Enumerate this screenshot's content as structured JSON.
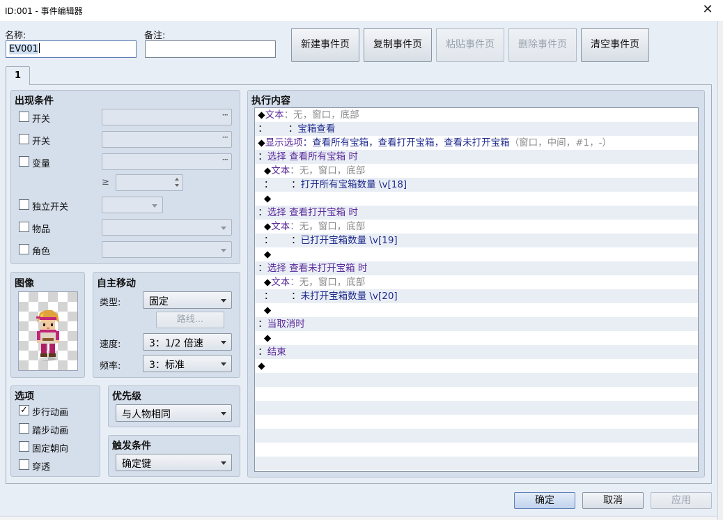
{
  "window": {
    "title": "ID:001 - 事件编辑器",
    "close_glyph": "✕"
  },
  "header": {
    "name_label": "名称:",
    "name_value": "EV001",
    "note_label": "备注:",
    "note_value": ""
  },
  "page_buttons": {
    "new": "新建事件页",
    "copy": "复制事件页",
    "paste": "粘贴事件页",
    "delete": "删除事件页",
    "clear": "清空事件页"
  },
  "tabs": [
    "1"
  ],
  "conditions": {
    "title": "出现条件",
    "switch1_label": "开关",
    "switch2_label": "开关",
    "variable_label": "变量",
    "ge_symbol": "≥",
    "self_switch_label": "独立开关",
    "item_label": "物品",
    "actor_label": "角色",
    "dots": "···"
  },
  "image": {
    "title": "图像",
    "character": "pink-haired-hero-sprite"
  },
  "autonomous_movement": {
    "title": "自主移动",
    "type_label": "类型:",
    "type_value": "固定",
    "route_button": "路线...",
    "speed_label": "速度:",
    "speed_value": "3：1/2 倍速",
    "freq_label": "频率:",
    "freq_value": "3：标准"
  },
  "options": {
    "title": "选项",
    "items": [
      {
        "label": "步行动画",
        "checked": true
      },
      {
        "label": "踏步动画",
        "checked": false
      },
      {
        "label": "固定朝向",
        "checked": false
      },
      {
        "label": "穿透",
        "checked": false
      }
    ],
    "check_glyph": "✓"
  },
  "priority": {
    "title": "优先级",
    "value": "与人物相同"
  },
  "trigger": {
    "title": "触发条件",
    "value": "确定键"
  },
  "contents": {
    "title": "执行内容",
    "rows": [
      [
        {
          "t": "◆",
          "c": "black"
        },
        {
          "t": "文本",
          "c": "purple"
        },
        {
          "t": "：无，窗口，底部",
          "c": "gray"
        }
      ],
      [
        {
          "t": "：       ：",
          "c": "black"
        },
        {
          "t": "宝箱查看",
          "c": "navy"
        }
      ],
      [
        {
          "t": "◆",
          "c": "black"
        },
        {
          "t": "显示选项",
          "c": "purple"
        },
        {
          "t": "：查看所有宝箱，查看打开宝箱，查看未打开宝箱",
          "c": "navy"
        },
        {
          "t": "（窗口，中间，#1，-）",
          "c": "gray"
        }
      ],
      [
        {
          "t": "：",
          "c": "black"
        },
        {
          "t": "选择 查看所有宝箱 时",
          "c": "purple"
        }
      ],
      [
        {
          "t": "  ◆",
          "c": "black"
        },
        {
          "t": "文本",
          "c": "purple"
        },
        {
          "t": "：无，窗口，底部",
          "c": "gray"
        }
      ],
      [
        {
          "t": "  ：      ：",
          "c": "black"
        },
        {
          "t": "打开所有宝箱数量 \\v[18]",
          "c": "navy"
        }
      ],
      [
        {
          "t": "  ◆",
          "c": "black"
        }
      ],
      [
        {
          "t": "：",
          "c": "black"
        },
        {
          "t": "选择 查看打开宝箱 时",
          "c": "purple"
        }
      ],
      [
        {
          "t": "  ◆",
          "c": "black"
        },
        {
          "t": "文本",
          "c": "purple"
        },
        {
          "t": "：无，窗口，底部",
          "c": "gray"
        }
      ],
      [
        {
          "t": "  ：      ：",
          "c": "black"
        },
        {
          "t": "已打开宝箱数量 \\v[19]",
          "c": "navy"
        }
      ],
      [
        {
          "t": "  ◆",
          "c": "black"
        }
      ],
      [
        {
          "t": "：",
          "c": "black"
        },
        {
          "t": "选择 查看未打开宝箱 时",
          "c": "purple"
        }
      ],
      [
        {
          "t": "  ◆",
          "c": "black"
        },
        {
          "t": "文本",
          "c": "purple"
        },
        {
          "t": "：无，窗口，底部",
          "c": "gray"
        }
      ],
      [
        {
          "t": "  ：      ：",
          "c": "black"
        },
        {
          "t": "未打开宝箱数量 \\v[20]",
          "c": "navy"
        }
      ],
      [
        {
          "t": "  ◆",
          "c": "black"
        }
      ],
      [
        {
          "t": "：",
          "c": "black"
        },
        {
          "t": "当取消时",
          "c": "purple"
        }
      ],
      [
        {
          "t": "  ◆",
          "c": "black"
        }
      ],
      [
        {
          "t": "：",
          "c": "black"
        },
        {
          "t": "结束",
          "c": "purple"
        }
      ],
      [
        {
          "t": "◆",
          "c": "black"
        }
      ]
    ]
  },
  "footer": {
    "ok": "确定",
    "cancel": "取消",
    "apply": "应用"
  },
  "colors": {
    "command_purple": "#5a2a9a",
    "command_navy": "#1e2a8c",
    "command_gray": "#8b8b8b",
    "panel_bg": "#d5deeb",
    "dialog_bg": "#e8eef6"
  }
}
